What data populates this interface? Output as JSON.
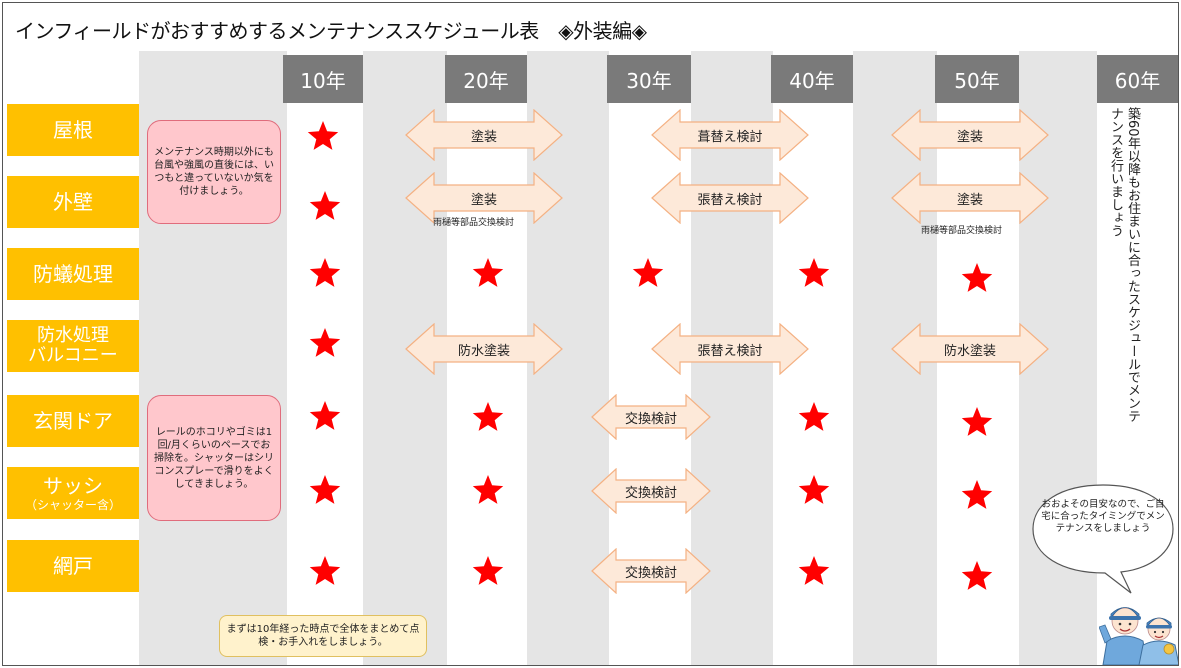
{
  "title": "インフィールドがおすすめするメンテナンススケジュール表　◈外装編◈",
  "years": [
    "10年",
    "20年",
    "30年",
    "40年",
    "50年",
    "60年"
  ],
  "categories": [
    {
      "line1": "屋根",
      "line2": ""
    },
    {
      "line1": "外壁",
      "line2": ""
    },
    {
      "line1": "防蟻処理",
      "line2": ""
    },
    {
      "line1": "防水処理",
      "line2": "バルコニー"
    },
    {
      "line1": "玄関ドア",
      "line2": ""
    },
    {
      "line1": "サッシ",
      "line2": "（シャッター含）"
    },
    {
      "line1": "網戸",
      "line2": ""
    }
  ],
  "arrows": {
    "roof_20": "塗装",
    "roof_35": "葺替え検討",
    "roof_50": "塗装",
    "wall_20": "塗装",
    "wall_35": "張替え検討",
    "wall_50": "塗装",
    "balc_20": "防水塗装",
    "balc_35": "張替え検討",
    "balc_50": "防水塗装",
    "door_30": "交換検討",
    "sash_30": "交換検討",
    "screen_30": "交換検討"
  },
  "sublabels": {
    "wall_20": "雨樋等部品交換検討",
    "wall_50": "雨樋等部品交換検討"
  },
  "notes": {
    "pink_top": "メンテナンス時期以外にも台風や強風の直後には、いつもと違っていないか気を付けましょう。",
    "pink_bottom": "レールのホコリやゴミは1回/月くらいのペースでお掃除を。シャッターはシリコンスプレーで滑りをよくしてきましょう。",
    "yellow": "まずは10年経った時点で全体をまとめて点検・お手入れをしましょう。",
    "vertical": "築60年以降もお住まいに合ったスケジュールでメンテナンスを行いましょう",
    "bubble": "おおよその目安なので、ご自宅に合ったタイミングでメンテナンスをしましょう"
  },
  "colors": {
    "category_bg": "#ffc000",
    "year_bg": "#7a7a7a",
    "band_bg": "#e5e5e5",
    "star": "#ff0000",
    "arrow_fill": "#fde9d9",
    "arrow_stroke": "#f4b183",
    "pink_note": "#ffc7cc",
    "yellow_note": "#fff2cc"
  }
}
